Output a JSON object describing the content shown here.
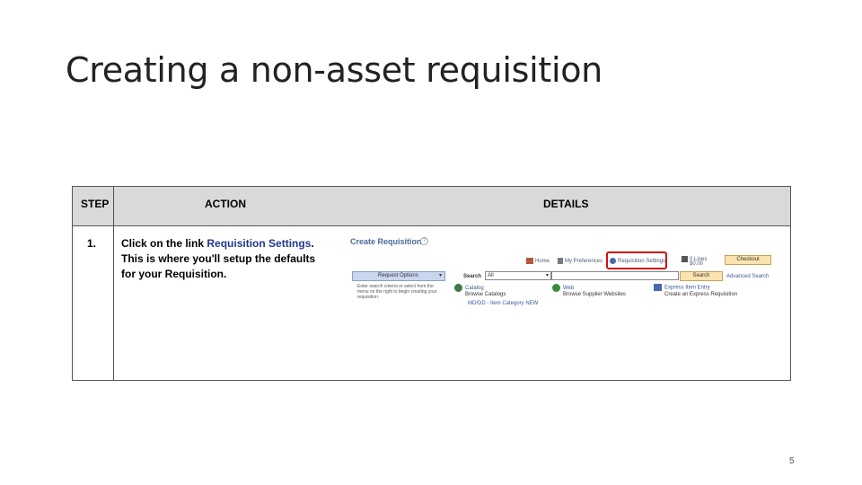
{
  "slide": {
    "title": "Creating a non-asset requisition",
    "page_number": "5"
  },
  "table": {
    "headers": {
      "step": "STEP",
      "action": "ACTION",
      "details": "DETAILS"
    },
    "row": {
      "step": "1.",
      "action_prefix": "Click on the link ",
      "action_link": "Requisition Settings",
      "action_suffix": ". This is where you'll setup the defaults for your Requisition."
    }
  },
  "screenshot": {
    "title": "Create Requisition",
    "help": "?",
    "nav": {
      "home": "Home",
      "preferences": "My Preferences",
      "requisition_settings": "Requisition Settings",
      "lines": "0 Lines",
      "lines_sub": "$0.00",
      "checkout": "Checkout"
    },
    "request_options": "Request Options",
    "search_label": "Search",
    "search_select": "All",
    "search_button": "Search",
    "advanced_search": "Advanced Search",
    "hint": "Enter search criteria or select from the menu on the right to begin creating your requisition.",
    "catalog": {
      "title": "Catalog",
      "sub": "Browse Catalogs",
      "extra": "MD/DD - Item Category NEW"
    },
    "web": {
      "title": "Web",
      "sub": "Browse Supplier Websites"
    },
    "express": {
      "title": "Express Item Entry",
      "sub": "Create an Express Requisition"
    }
  },
  "colors": {
    "highlight": "#d01010",
    "header_bg": "#d9d9d9",
    "link": "#1f3a8a"
  }
}
